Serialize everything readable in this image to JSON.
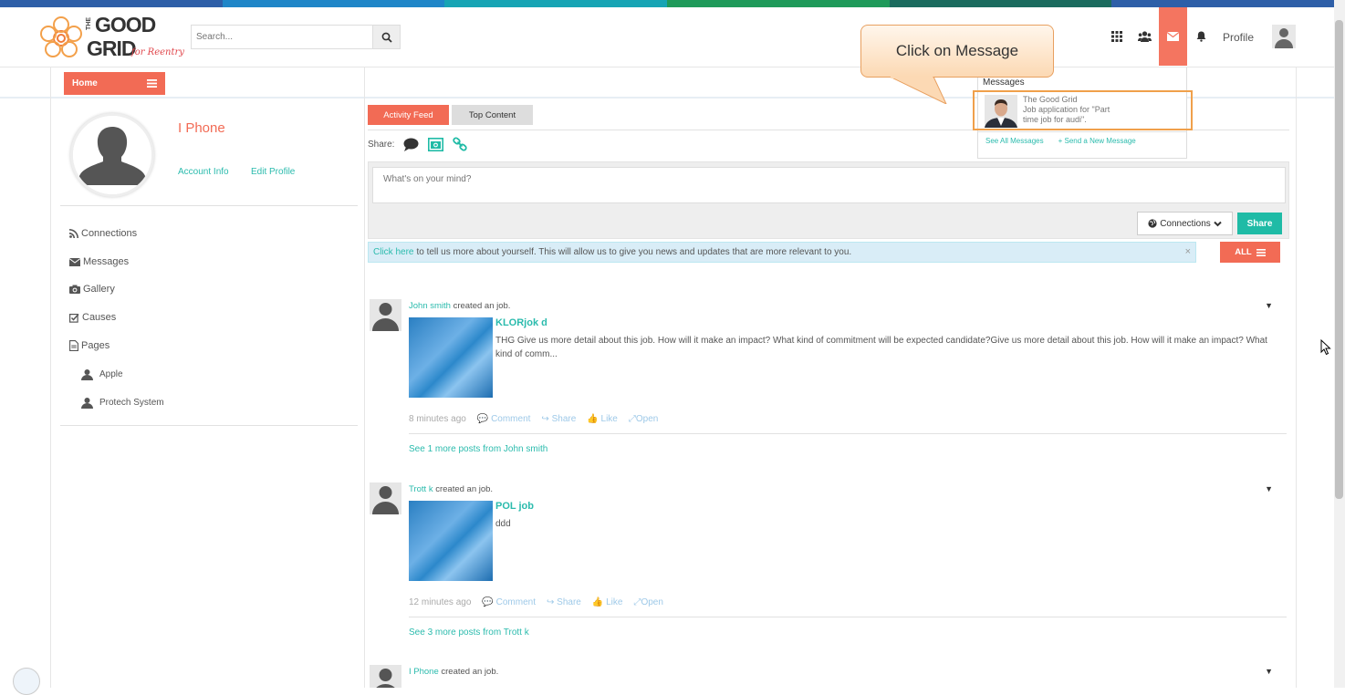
{
  "colors": {
    "accent": "#f26b55",
    "teal": "#2bbbad",
    "stripe": [
      "#2e5fa8",
      "#1f86c8",
      "#17a4b4",
      "#1f9a5a",
      "#1b6b5e",
      "#2e5fa8"
    ]
  },
  "logo": {
    "line1": "THE",
    "line2": "GOOD",
    "line3": "GRID",
    "tagline": "for Reentry"
  },
  "search": {
    "placeholder": "Search..."
  },
  "header": {
    "icons": [
      "grid-icon",
      "users-icon",
      "envelope-icon",
      "bell-icon"
    ],
    "profile_label": "Profile"
  },
  "subbar": {
    "home_label": "Home"
  },
  "profile": {
    "name": "I Phone",
    "account_info": "Account Info",
    "edit_profile": "Edit Profile"
  },
  "sidebar": {
    "items": [
      {
        "label": "Connections",
        "icon": "rss-icon"
      },
      {
        "label": "Messages",
        "icon": "envelope-icon"
      },
      {
        "label": "Gallery",
        "icon": "camera-icon"
      },
      {
        "label": "Causes",
        "icon": "checkbox-icon"
      },
      {
        "label": "Pages",
        "icon": "file-icon"
      }
    ],
    "pages": [
      {
        "label": "Apple"
      },
      {
        "label": "Protech System"
      }
    ]
  },
  "tabs": {
    "activity": "Activity Feed",
    "top": "Top Content"
  },
  "share": {
    "label": "Share:",
    "placeholder": "What's on your mind?",
    "connections": "Connections",
    "share_btn": "Share"
  },
  "info": {
    "link": "Click here",
    "text": "to tell us more about yourself. This will allow us to give you news and updates that are more relevant to you.",
    "close": "×"
  },
  "filter": {
    "all": "ALL"
  },
  "posts": [
    {
      "user": "John smith",
      "action": "created an job.",
      "title": "KLORjok d",
      "text": "THG Give us more detail about this job. How will it make an impact? What kind of commitment will be expected candidate?Give us more detail about this job. How will it make an impact? What kind of comm...",
      "time": "8 minutes ago",
      "comment": "Comment",
      "share": "Share",
      "like": "Like",
      "open": "Open",
      "more": "See 1 more posts from John smith"
    },
    {
      "user": "Trott k",
      "action": "created an job.",
      "title": "POL job",
      "text": "ddd",
      "time": "12 minutes ago",
      "comment": "Comment",
      "share": "Share",
      "like": "Like",
      "open": "Open",
      "more": "See 3 more posts from Trott k"
    },
    {
      "user": "I Phone",
      "action": "created an job."
    }
  ],
  "messages": {
    "title": "Messages",
    "sender": "The Good Grid",
    "preview_line1": "Job application for \"Part",
    "preview_line2": "time job for audi\".",
    "see_all": "See All Messages",
    "send_new": "+ Send a New Message"
  },
  "callout": {
    "text": "Click on Message"
  }
}
